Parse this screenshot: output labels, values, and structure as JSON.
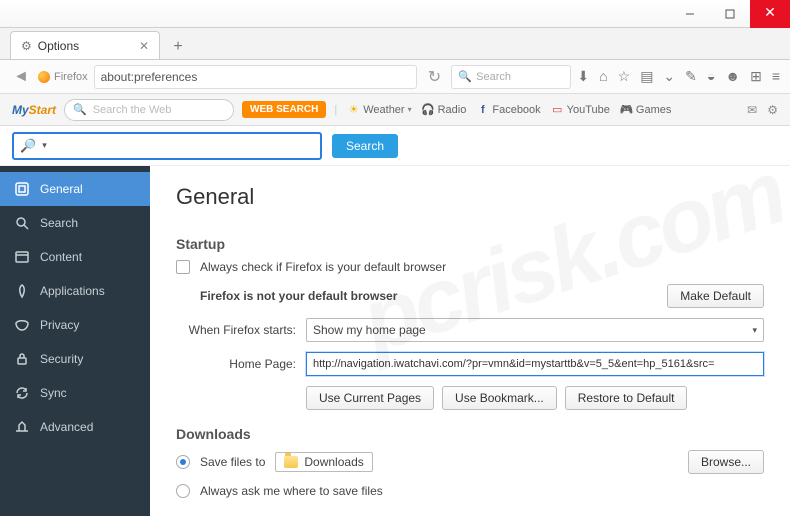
{
  "window": {
    "tab_title": "Options"
  },
  "urlbar": {
    "brand": "Firefox",
    "address": "about:preferences",
    "search_placeholder": "Search"
  },
  "mystart": {
    "logo_a": "My",
    "logo_b": "Start",
    "search_placeholder": "Search the Web",
    "web_search": "WEB SEARCH",
    "links": {
      "weather": "Weather",
      "radio": "Radio",
      "facebook": "Facebook",
      "youtube": "YouTube",
      "games": "Games"
    }
  },
  "searchrow": {
    "button": "Search"
  },
  "sidebar": {
    "items": [
      {
        "key": "general",
        "label": "General"
      },
      {
        "key": "search",
        "label": "Search"
      },
      {
        "key": "content",
        "label": "Content"
      },
      {
        "key": "applications",
        "label": "Applications"
      },
      {
        "key": "privacy",
        "label": "Privacy"
      },
      {
        "key": "security",
        "label": "Security"
      },
      {
        "key": "sync",
        "label": "Sync"
      },
      {
        "key": "advanced",
        "label": "Advanced"
      }
    ]
  },
  "prefs": {
    "heading": "General",
    "startup": {
      "title": "Startup",
      "always_check": "Always check if Firefox is your default browser",
      "not_default": "Firefox is not your default browser",
      "make_default": "Make Default",
      "when_starts_label": "When Firefox starts:",
      "when_starts_value": "Show my home page",
      "home_page_label": "Home Page:",
      "home_page_value": "http://navigation.iwatchavi.com/?pr=vmn&id=mystarttb&v=5_5&ent=hp_5161&src=",
      "use_current": "Use Current Pages",
      "use_bookmark": "Use Bookmark...",
      "restore_default": "Restore to Default"
    },
    "downloads": {
      "title": "Downloads",
      "save_to": "Save files to",
      "folder": "Downloads",
      "browse": "Browse...",
      "ask": "Always ask me where to save files"
    }
  },
  "watermark": "pcrisk.com"
}
